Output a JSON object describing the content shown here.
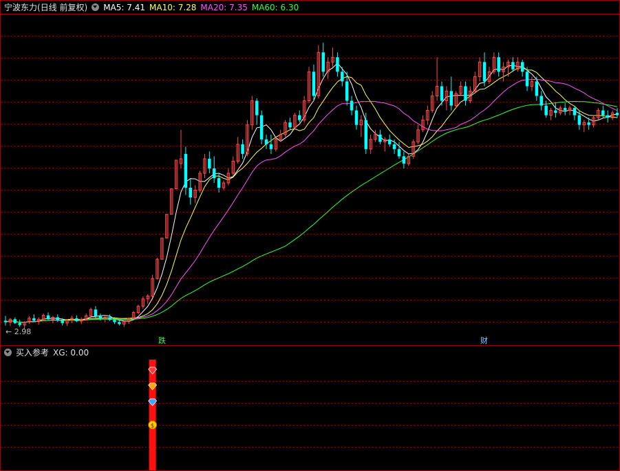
{
  "title": "宁波东力",
  "period": "(日线 前复权)",
  "ma_readings": [
    {
      "label": "MA5:",
      "value": "7.41",
      "color": "#ffffff"
    },
    {
      "label": "MA10:",
      "value": "7.28",
      "color": "#ffff55"
    },
    {
      "label": "MA20:",
      "value": "7.35",
      "color": "#ff55ff"
    },
    {
      "label": "MA60:",
      "value": "6.30",
      "color": "#33ff33"
    }
  ],
  "price_marker": "← 2.98",
  "events": [
    {
      "text": "跌",
      "color": "#33ff33"
    },
    {
      "text": "财",
      "color": "#88ccff"
    }
  ],
  "indicator": {
    "name": "买入参考",
    "xg_label": "XG:",
    "xg_value": "0.00"
  },
  "colors": {
    "up": "#ff4a4a",
    "down": "#00ffff",
    "bg": "#000000",
    "grid": "#8b0000",
    "frame": "#a00000"
  },
  "chart_data": {
    "type": "candlestick",
    "price_range": [
      2.7,
      9.5
    ],
    "lowest_marked": 2.98,
    "candles": [
      {
        "o": 3.15,
        "h": 3.25,
        "l": 3.05,
        "c": 3.12
      },
      {
        "o": 3.12,
        "h": 3.2,
        "l": 3.04,
        "c": 3.18
      },
      {
        "o": 3.18,
        "h": 3.22,
        "l": 3.08,
        "c": 3.1
      },
      {
        "o": 3.1,
        "h": 3.17,
        "l": 3.02,
        "c": 3.06
      },
      {
        "o": 3.06,
        "h": 3.14,
        "l": 2.98,
        "c": 3.12
      },
      {
        "o": 3.12,
        "h": 3.24,
        "l": 3.08,
        "c": 3.2
      },
      {
        "o": 3.2,
        "h": 3.28,
        "l": 3.12,
        "c": 3.15
      },
      {
        "o": 3.15,
        "h": 3.22,
        "l": 3.07,
        "c": 3.18
      },
      {
        "o": 3.18,
        "h": 3.3,
        "l": 3.14,
        "c": 3.26
      },
      {
        "o": 3.26,
        "h": 3.32,
        "l": 3.15,
        "c": 3.18
      },
      {
        "o": 3.18,
        "h": 3.25,
        "l": 3.1,
        "c": 3.22
      },
      {
        "o": 3.22,
        "h": 3.28,
        "l": 3.12,
        "c": 3.15
      },
      {
        "o": 3.15,
        "h": 3.2,
        "l": 3.05,
        "c": 3.1
      },
      {
        "o": 3.1,
        "h": 3.18,
        "l": 3.04,
        "c": 3.16
      },
      {
        "o": 3.16,
        "h": 3.25,
        "l": 3.1,
        "c": 3.2
      },
      {
        "o": 3.2,
        "h": 3.26,
        "l": 3.12,
        "c": 3.14
      },
      {
        "o": 3.14,
        "h": 3.22,
        "l": 3.08,
        "c": 3.18
      },
      {
        "o": 3.18,
        "h": 3.3,
        "l": 3.15,
        "c": 3.25
      },
      {
        "o": 3.25,
        "h": 3.42,
        "l": 3.2,
        "c": 3.38
      },
      {
        "o": 3.38,
        "h": 3.45,
        "l": 3.2,
        "c": 3.24
      },
      {
        "o": 3.24,
        "h": 3.3,
        "l": 3.15,
        "c": 3.2
      },
      {
        "o": 3.2,
        "h": 3.26,
        "l": 3.12,
        "c": 3.22
      },
      {
        "o": 3.22,
        "h": 3.28,
        "l": 3.14,
        "c": 3.17
      },
      {
        "o": 3.17,
        "h": 3.22,
        "l": 3.08,
        "c": 3.12
      },
      {
        "o": 3.12,
        "h": 3.18,
        "l": 3.05,
        "c": 3.08
      },
      {
        "o": 3.08,
        "h": 3.15,
        "l": 3.02,
        "c": 3.13
      },
      {
        "o": 3.13,
        "h": 3.22,
        "l": 3.08,
        "c": 3.2
      },
      {
        "o": 3.2,
        "h": 3.35,
        "l": 3.18,
        "c": 3.32
      },
      {
        "o": 3.32,
        "h": 3.48,
        "l": 3.28,
        "c": 3.45
      },
      {
        "o": 3.45,
        "h": 3.65,
        "l": 3.4,
        "c": 3.6
      },
      {
        "o": 3.6,
        "h": 3.7,
        "l": 3.5,
        "c": 3.66
      },
      {
        "o": 3.66,
        "h": 4.1,
        "l": 3.62,
        "c": 4.02
      },
      {
        "o": 4.02,
        "h": 4.45,
        "l": 4.0,
        "c": 4.42
      },
      {
        "o": 4.42,
        "h": 4.86,
        "l": 4.42,
        "c": 4.86
      },
      {
        "o": 4.86,
        "h": 5.35,
        "l": 4.86,
        "c": 5.35
      },
      {
        "o": 5.35,
        "h": 5.88,
        "l": 5.35,
        "c": 5.88
      },
      {
        "o": 5.88,
        "h": 6.47,
        "l": 5.88,
        "c": 6.47
      },
      {
        "o": 6.4,
        "h": 7.1,
        "l": 6.3,
        "c": 6.5
      },
      {
        "o": 6.6,
        "h": 6.75,
        "l": 5.75,
        "c": 5.9
      },
      {
        "o": 5.9,
        "h": 6.1,
        "l": 5.55,
        "c": 5.7
      },
      {
        "o": 5.7,
        "h": 5.95,
        "l": 5.58,
        "c": 5.85
      },
      {
        "o": 5.85,
        "h": 6.25,
        "l": 5.8,
        "c": 6.2
      },
      {
        "o": 6.2,
        "h": 6.6,
        "l": 6.1,
        "c": 6.5
      },
      {
        "o": 6.5,
        "h": 6.65,
        "l": 6.2,
        "c": 6.3
      },
      {
        "o": 6.3,
        "h": 6.55,
        "l": 6.0,
        "c": 6.1
      },
      {
        "o": 6.1,
        "h": 6.2,
        "l": 5.8,
        "c": 5.9
      },
      {
        "o": 5.9,
        "h": 6.05,
        "l": 5.85,
        "c": 6.0
      },
      {
        "o": 6.0,
        "h": 6.3,
        "l": 5.95,
        "c": 6.2
      },
      {
        "o": 6.2,
        "h": 6.55,
        "l": 6.15,
        "c": 6.45
      },
      {
        "o": 6.45,
        "h": 6.95,
        "l": 6.4,
        "c": 6.8
      },
      {
        "o": 6.8,
        "h": 6.9,
        "l": 6.5,
        "c": 6.6
      },
      {
        "o": 6.6,
        "h": 7.3,
        "l": 6.55,
        "c": 7.2
      },
      {
        "o": 7.2,
        "h": 7.8,
        "l": 7.1,
        "c": 7.7
      },
      {
        "o": 7.7,
        "h": 7.75,
        "l": 7.2,
        "c": 7.4
      },
      {
        "o": 7.4,
        "h": 7.5,
        "l": 6.8,
        "c": 6.9
      },
      {
        "o": 6.9,
        "h": 7.0,
        "l": 6.7,
        "c": 6.8
      },
      {
        "o": 6.8,
        "h": 7.0,
        "l": 6.6,
        "c": 6.7
      },
      {
        "o": 6.7,
        "h": 6.95,
        "l": 6.65,
        "c": 6.9
      },
      {
        "o": 6.9,
        "h": 7.1,
        "l": 6.85,
        "c": 7.0
      },
      {
        "o": 7.0,
        "h": 7.3,
        "l": 6.95,
        "c": 7.25
      },
      {
        "o": 7.25,
        "h": 7.35,
        "l": 7.1,
        "c": 7.15
      },
      {
        "o": 7.15,
        "h": 7.45,
        "l": 7.1,
        "c": 7.4
      },
      {
        "o": 7.4,
        "h": 7.5,
        "l": 7.25,
        "c": 7.3
      },
      {
        "o": 7.3,
        "h": 7.8,
        "l": 7.25,
        "c": 7.7
      },
      {
        "o": 7.7,
        "h": 8.4,
        "l": 7.65,
        "c": 8.3
      },
      {
        "o": 8.3,
        "h": 8.45,
        "l": 7.7,
        "c": 7.8
      },
      {
        "o": 7.8,
        "h": 8.85,
        "l": 7.75,
        "c": 8.7
      },
      {
        "o": 8.7,
        "h": 8.9,
        "l": 8.2,
        "c": 8.3
      },
      {
        "o": 8.3,
        "h": 8.6,
        "l": 8.15,
        "c": 8.5
      },
      {
        "o": 8.5,
        "h": 8.8,
        "l": 8.4,
        "c": 8.6
      },
      {
        "o": 8.6,
        "h": 8.7,
        "l": 8.2,
        "c": 8.3
      },
      {
        "o": 8.3,
        "h": 8.4,
        "l": 8.0,
        "c": 8.1
      },
      {
        "o": 8.1,
        "h": 8.3,
        "l": 7.6,
        "c": 7.7
      },
      {
        "o": 7.7,
        "h": 7.8,
        "l": 7.4,
        "c": 7.5
      },
      {
        "o": 7.5,
        "h": 7.6,
        "l": 7.1,
        "c": 7.2
      },
      {
        "o": 7.2,
        "h": 7.4,
        "l": 6.95,
        "c": 7.3
      },
      {
        "o": 7.3,
        "h": 7.45,
        "l": 6.6,
        "c": 6.7
      },
      {
        "o": 6.7,
        "h": 7.0,
        "l": 6.6,
        "c": 6.9
      },
      {
        "o": 6.9,
        "h": 7.1,
        "l": 6.85,
        "c": 7.0
      },
      {
        "o": 7.0,
        "h": 7.1,
        "l": 6.8,
        "c": 6.85
      },
      {
        "o": 6.85,
        "h": 6.95,
        "l": 6.65,
        "c": 6.9
      },
      {
        "o": 6.9,
        "h": 7.0,
        "l": 6.75,
        "c": 6.8
      },
      {
        "o": 6.8,
        "h": 6.9,
        "l": 6.6,
        "c": 6.7
      },
      {
        "o": 6.7,
        "h": 6.85,
        "l": 6.5,
        "c": 6.55
      },
      {
        "o": 6.55,
        "h": 6.65,
        "l": 6.3,
        "c": 6.4
      },
      {
        "o": 6.4,
        "h": 6.6,
        "l": 6.35,
        "c": 6.55
      },
      {
        "o": 6.55,
        "h": 6.9,
        "l": 6.5,
        "c": 6.85
      },
      {
        "o": 6.85,
        "h": 7.2,
        "l": 6.8,
        "c": 7.1
      },
      {
        "o": 7.1,
        "h": 7.4,
        "l": 7.05,
        "c": 7.3
      },
      {
        "o": 7.3,
        "h": 7.6,
        "l": 7.2,
        "c": 7.5
      },
      {
        "o": 7.5,
        "h": 7.9,
        "l": 7.45,
        "c": 7.8
      },
      {
        "o": 7.8,
        "h": 8.6,
        "l": 7.7,
        "c": 8.0
      },
      {
        "o": 8.0,
        "h": 8.1,
        "l": 7.6,
        "c": 7.7
      },
      {
        "o": 7.7,
        "h": 8.0,
        "l": 7.5,
        "c": 7.9
      },
      {
        "o": 7.9,
        "h": 8.2,
        "l": 7.5,
        "c": 7.6
      },
      {
        "o": 7.6,
        "h": 7.9,
        "l": 7.55,
        "c": 7.85
      },
      {
        "o": 7.85,
        "h": 8.1,
        "l": 7.8,
        "c": 8.0
      },
      {
        "o": 8.0,
        "h": 8.1,
        "l": 7.6,
        "c": 7.7
      },
      {
        "o": 7.7,
        "h": 8.0,
        "l": 7.65,
        "c": 7.9
      },
      {
        "o": 7.9,
        "h": 8.3,
        "l": 7.85,
        "c": 8.2
      },
      {
        "o": 8.2,
        "h": 8.6,
        "l": 8.1,
        "c": 8.5
      },
      {
        "o": 8.5,
        "h": 8.7,
        "l": 8.0,
        "c": 8.1
      },
      {
        "o": 8.1,
        "h": 8.4,
        "l": 8.05,
        "c": 8.3
      },
      {
        "o": 8.3,
        "h": 8.7,
        "l": 8.25,
        "c": 8.6
      },
      {
        "o": 8.6,
        "h": 8.7,
        "l": 8.2,
        "c": 8.3
      },
      {
        "o": 8.3,
        "h": 8.5,
        "l": 8.1,
        "c": 8.4
      },
      {
        "o": 8.4,
        "h": 8.55,
        "l": 8.2,
        "c": 8.5
      },
      {
        "o": 8.5,
        "h": 8.6,
        "l": 8.3,
        "c": 8.35
      },
      {
        "o": 8.35,
        "h": 8.6,
        "l": 8.3,
        "c": 8.5
      },
      {
        "o": 8.5,
        "h": 8.55,
        "l": 8.2,
        "c": 8.3
      },
      {
        "o": 8.3,
        "h": 8.4,
        "l": 7.9,
        "c": 8.0
      },
      {
        "o": 8.0,
        "h": 8.2,
        "l": 7.9,
        "c": 8.1
      },
      {
        "o": 8.1,
        "h": 8.2,
        "l": 7.7,
        "c": 7.8
      },
      {
        "o": 7.8,
        "h": 7.9,
        "l": 7.5,
        "c": 7.6
      },
      {
        "o": 7.6,
        "h": 7.7,
        "l": 7.35,
        "c": 7.4
      },
      {
        "o": 7.4,
        "h": 7.55,
        "l": 7.3,
        "c": 7.5
      },
      {
        "o": 7.5,
        "h": 7.65,
        "l": 7.35,
        "c": 7.45
      },
      {
        "o": 7.45,
        "h": 7.6,
        "l": 7.4,
        "c": 7.55
      },
      {
        "o": 7.55,
        "h": 7.65,
        "l": 7.4,
        "c": 7.5
      },
      {
        "o": 7.5,
        "h": 7.6,
        "l": 7.4,
        "c": 7.55
      },
      {
        "o": 7.55,
        "h": 7.6,
        "l": 7.3,
        "c": 7.4
      },
      {
        "o": 7.4,
        "h": 7.5,
        "l": 7.1,
        "c": 7.2
      },
      {
        "o": 7.2,
        "h": 7.3,
        "l": 7.05,
        "c": 7.25
      },
      {
        "o": 7.25,
        "h": 7.35,
        "l": 7.1,
        "c": 7.2
      },
      {
        "o": 7.2,
        "h": 7.4,
        "l": 7.15,
        "c": 7.35
      },
      {
        "o": 7.35,
        "h": 7.55,
        "l": 7.3,
        "c": 7.5
      },
      {
        "o": 7.5,
        "h": 7.6,
        "l": 7.35,
        "c": 7.4
      },
      {
        "o": 7.4,
        "h": 7.5,
        "l": 7.25,
        "c": 7.35
      },
      {
        "o": 7.35,
        "h": 7.5,
        "l": 7.3,
        "c": 7.45
      },
      {
        "o": 7.45,
        "h": 7.55,
        "l": 7.35,
        "c": 7.4
      }
    ],
    "signal_index": 31,
    "signal_marks": [
      {
        "type": "red-triangle-gem",
        "color": "#ff3b3b"
      },
      {
        "type": "yellow-gem",
        "color": "#ffaa00"
      },
      {
        "type": "blue-diamond",
        "color": "#33aaff"
      },
      {
        "type": "dollar-money-bag",
        "color": "#ffcc00"
      }
    ]
  }
}
